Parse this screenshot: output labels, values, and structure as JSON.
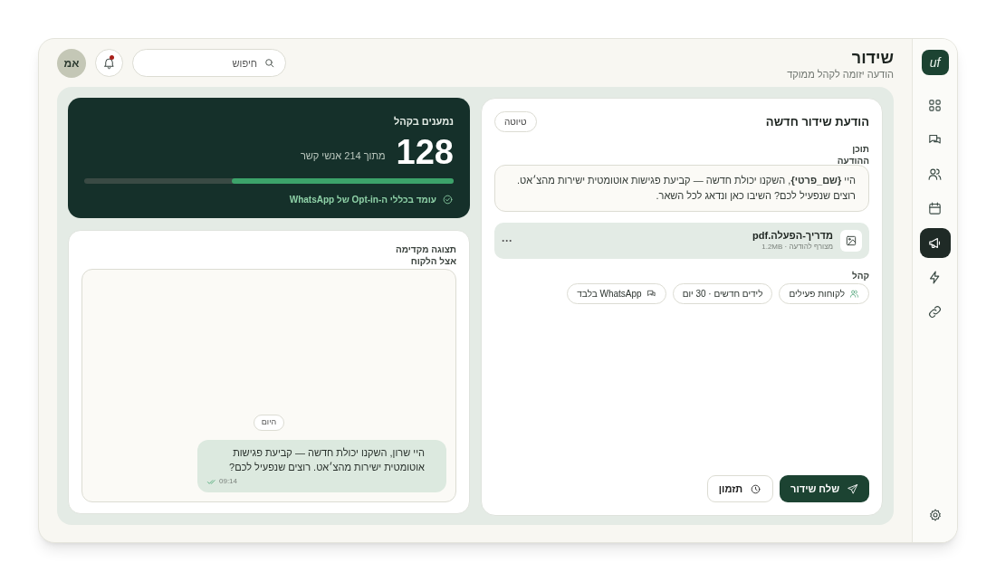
{
  "sidebar": {
    "logo": "uf",
    "items": [
      {
        "kind": "grid",
        "selected": false
      },
      {
        "kind": "chat",
        "selected": false
      },
      {
        "kind": "users",
        "selected": false
      },
      {
        "kind": "calendar",
        "selected": false
      },
      {
        "kind": "megaphone",
        "selected": true
      },
      {
        "kind": "bolt",
        "selected": false
      },
      {
        "kind": "link",
        "selected": false
      }
    ]
  },
  "header": {
    "title": "שידור",
    "subtitle": "הודעה יזומה לקהל ממוקד",
    "search": {
      "placeholder": "חיפוש"
    },
    "notifications": {
      "unread": true
    },
    "avatar": "אמ"
  },
  "composer": {
    "title": "הודעת שידור חדשה",
    "status": "טיוטה",
    "content_label": "תוכן ההודעה",
    "message": "היי **{שם_פרטי}**, השקנו יכולת חדשה — קביעת פגישות אוטומטית ישירות מהצ׳אט. רוצים שנפעיל לכם? השיבו כאן ונדאג לכל השאר.",
    "attachment": {
      "name": "מדריך-הפעלה.pdf",
      "meta": "מצורף להודעה · 1.2MB",
      "menu": "···"
    },
    "audience_label": "קהל",
    "chips": [
      {
        "kind": "users",
        "label": "לקוחות פעילים"
      },
      {
        "kind": "plain",
        "label": "לידים חדשים · 30 יום"
      },
      {
        "kind": "chat",
        "label": "WhatsApp בלבד"
      }
    ],
    "buttons": [
      {
        "kind": "primary",
        "label": "שלח שידור"
      },
      {
        "kind": "secondary",
        "label": "תזמון"
      }
    ]
  },
  "audience": {
    "title": "נמענים בקהל",
    "count": "128",
    "of_total": "מתוך 214 אנשי קשר",
    "level": 0.6,
    "compliance": "עומד בכללי ה-Opt-in של WhatsApp"
  },
  "preview": {
    "title": "תצוגה מקדימה אצל הלקוח",
    "day": "היום",
    "bubble": "היי שרון, השקנו יכולת חדשה — קביעת פגישות אוטומטית ישירות מהצ׳אט. רוצים שנפעיל לכם?",
    "time": "09:14",
    "read": true
  }
}
